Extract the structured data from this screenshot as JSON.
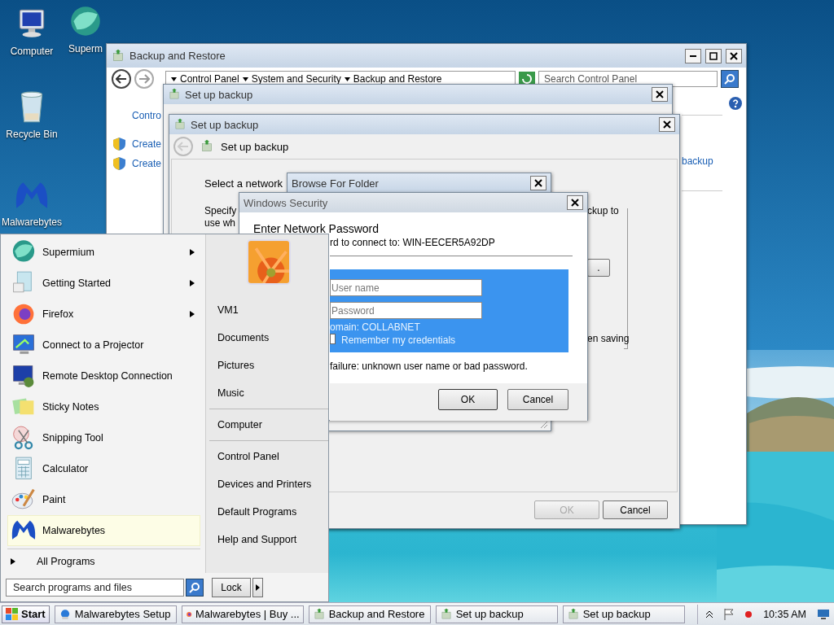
{
  "desktop_icons": [
    {
      "label": "Computer",
      "kind": "computer"
    },
    {
      "label": "Superm",
      "kind": "supermium"
    },
    {
      "label": "Recycle Bin",
      "kind": "recycle"
    },
    {
      "label": "Malwarebytes",
      "kind": "malwarebytes"
    }
  ],
  "backup_window": {
    "title": "Backup and Restore",
    "breadcrumb": [
      "Control Panel",
      "System and Security",
      "Backup and Restore"
    ],
    "search": {
      "placeholder": "Search Control Panel"
    },
    "sidebar": [
      {
        "label": "Contro",
        "kind": "link"
      },
      {
        "label": "Create",
        "kind": "shield"
      },
      {
        "label": "Create",
        "kind": "shield"
      }
    ],
    "right_link": "backup"
  },
  "setup_back_window": {
    "title": "Set up backup"
  },
  "setup_window": {
    "title": "Set up backup",
    "header": "Set up backup",
    "network_label": "Select a network",
    "specify_lines": [
      "Specify",
      "use wh"
    ],
    "right_texts": [
      "ckup to",
      "en saving"
    ],
    "browse_button": ".",
    "buttons": [
      {
        "label": "OK",
        "disabled": true
      },
      {
        "label": "Cancel",
        "disabled": false
      }
    ]
  },
  "browse_dialog": {
    "title": "Browse For Folder"
  },
  "security_dialog": {
    "title": "Windows Security",
    "heading": "Enter Network Password",
    "prompt": "rd to connect to: WIN-EECER5A92DP",
    "username": {
      "placeholder": "User name"
    },
    "password": {
      "placeholder": "Password"
    },
    "domain": "omain: COLLABNET",
    "remember": {
      "label": "Remember my credentials",
      "checked": false
    },
    "error": "failure: unknown user name or bad password.",
    "buttons": [
      {
        "label": "OK"
      },
      {
        "label": "Cancel"
      }
    ]
  },
  "start_menu": {
    "programs": [
      {
        "label": "Supermium",
        "kind": "supermium",
        "submenu": true,
        "selected": false
      },
      {
        "label": "Getting Started",
        "kind": "document",
        "submenu": true,
        "selected": false
      },
      {
        "label": "Firefox",
        "kind": "firefox",
        "submenu": true,
        "selected": false
      },
      {
        "label": "Connect to a Projector",
        "kind": "projector",
        "submenu": false,
        "selected": false
      },
      {
        "label": "Remote Desktop Connection",
        "kind": "remote",
        "submenu": false,
        "selected": false
      },
      {
        "label": "Sticky Notes",
        "kind": "notes",
        "submenu": false,
        "selected": false
      },
      {
        "label": "Snipping Tool",
        "kind": "scissors",
        "submenu": false,
        "selected": false
      },
      {
        "label": "Calculator",
        "kind": "calculator",
        "submenu": false,
        "selected": false
      },
      {
        "label": "Paint",
        "kind": "paint",
        "submenu": false,
        "selected": false
      },
      {
        "label": "Malwarebytes",
        "kind": "malwarebytes",
        "submenu": false,
        "selected": true
      }
    ],
    "all_programs": "All Programs",
    "search": {
      "placeholder": "Search programs and files"
    },
    "places": [
      [
        "VM1",
        "Documents",
        "Pictures",
        "Music"
      ],
      [
        "Computer"
      ],
      [
        "Control Panel",
        "Devices and Printers",
        "Default Programs",
        "Help and Support"
      ]
    ],
    "lock": "Lock"
  },
  "taskbar": {
    "start": "Start",
    "tasks": [
      {
        "label": "Malwarebytes Setup",
        "kind": "setup"
      },
      {
        "label": "Malwarebytes | Buy ...",
        "kind": "firefox"
      },
      {
        "label": "Backup and Restore",
        "kind": "backup"
      },
      {
        "label": "Set up backup",
        "kind": "backup"
      },
      {
        "label": "Set up backup",
        "kind": "backup"
      }
    ],
    "clock": "10:35 AM"
  }
}
